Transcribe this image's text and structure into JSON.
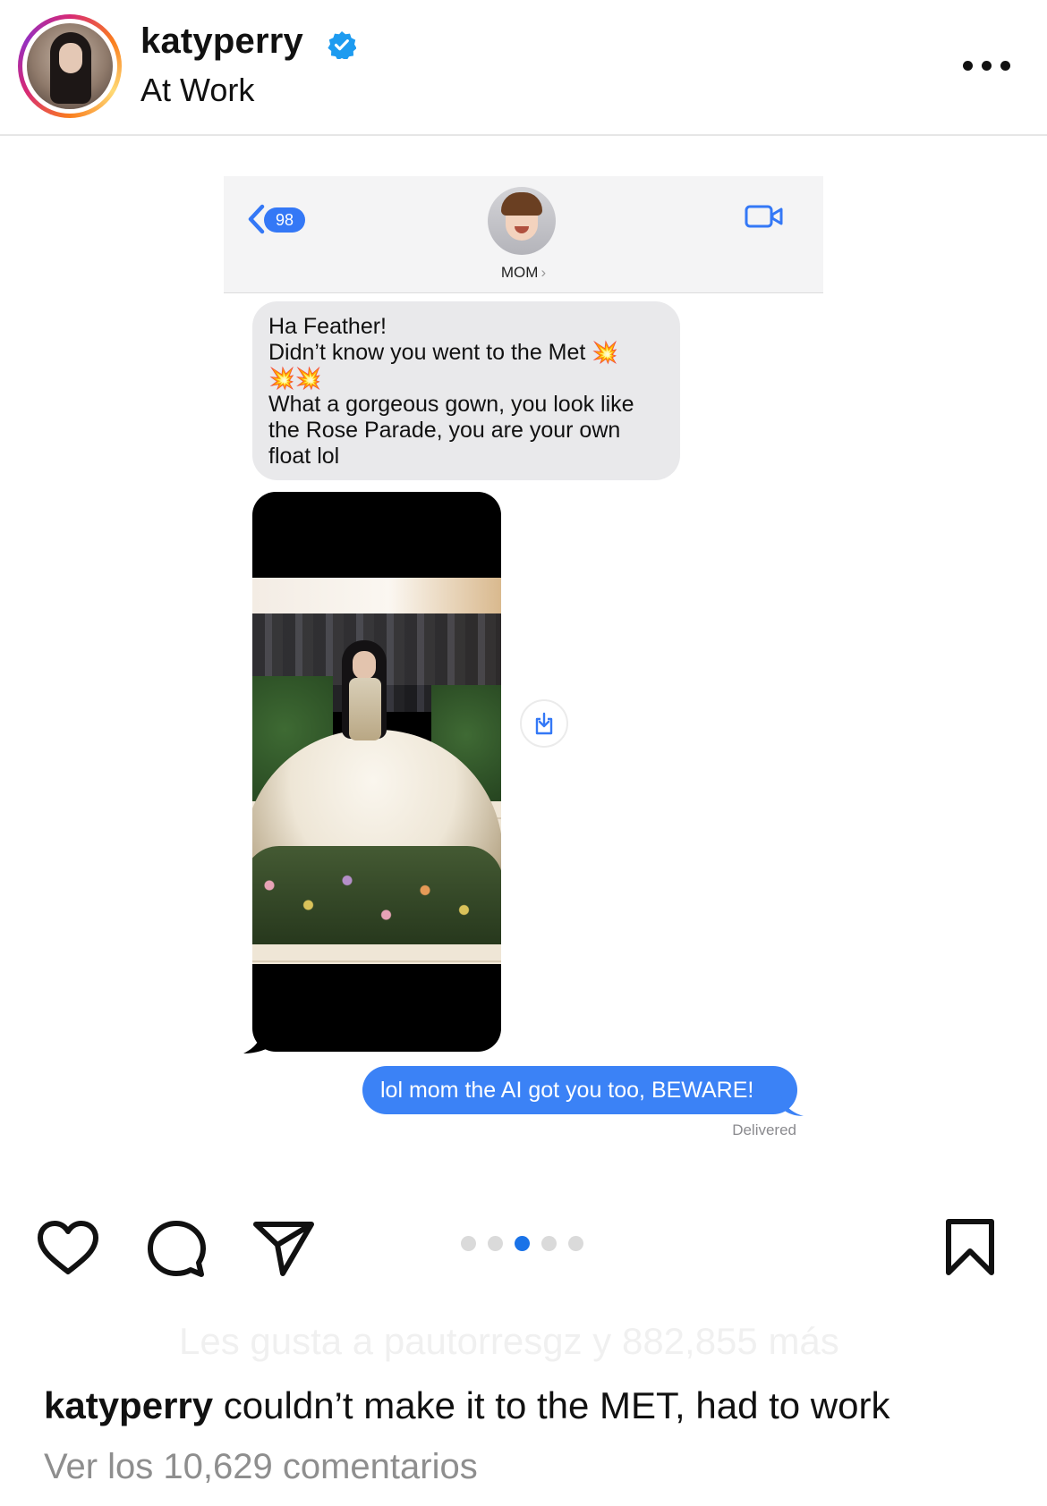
{
  "header": {
    "username": "katyperry",
    "location": "At Work",
    "verified": true
  },
  "message_screenshot": {
    "back_badge": "98",
    "contact_name": "MOM",
    "incoming": {
      "line1": "Ha Feather!",
      "line2": "Didn’t know you went to the Met",
      "line4": "What a gorgeous gown, you look like",
      "line5": "the Rose Parade, you are your own",
      "line6": "float lol",
      "emoji": "💥"
    },
    "outgoing": "lol mom the AI got you too, BEWARE!",
    "status": "Delivered",
    "colors": {
      "outgoing_bubble": "#3b82f6",
      "incoming_bubble": "#e9e9eb",
      "ios_blue": "#3478f6"
    }
  },
  "actions": {
    "icons": [
      "heart-icon",
      "comment-icon",
      "share-icon",
      "bookmark-icon"
    ],
    "carousel": {
      "total": 5,
      "active_index": 2
    }
  },
  "likes_text": "Les gusta a pautorresgz y 882,855 más",
  "caption": {
    "user": "katyperry",
    "text": "couldn’t make it to the MET, had to work"
  },
  "comments_link": "Ver los 10,629 comentarios",
  "colors": {
    "verified_badge": "#1d9bf0",
    "carousel_active": "#1a73e8"
  }
}
